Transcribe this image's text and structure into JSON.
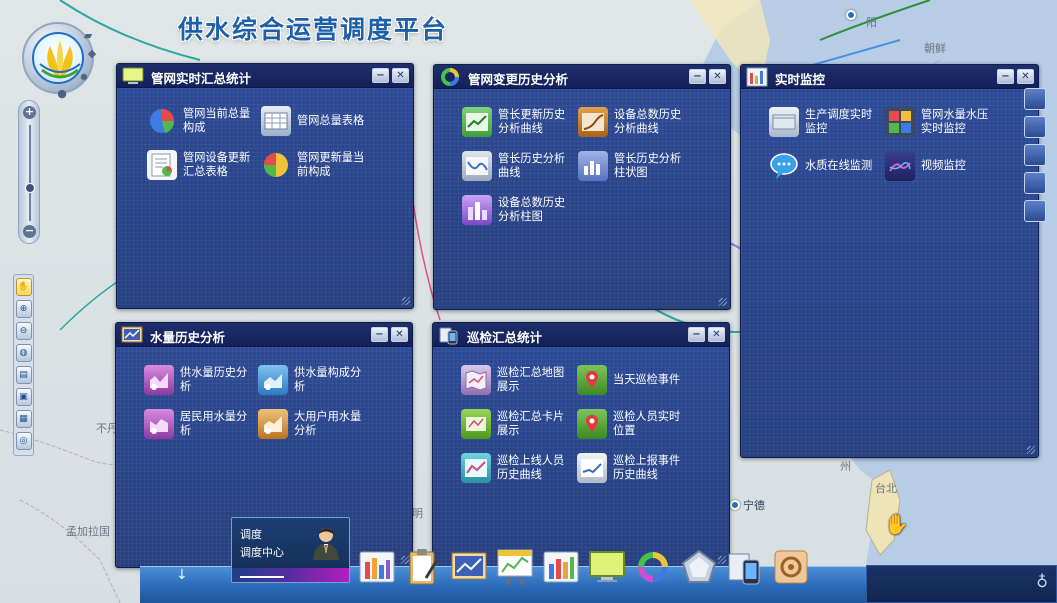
{
  "app": {
    "title": "供水综合运营调度平台"
  },
  "map_labels": {
    "yang": "阳",
    "shenyang": "沈阳",
    "chaoxian": "朝鲜",
    "bu": "不丹",
    "mengjiala": "孟加拉国",
    "kunming": "昆明",
    "zhou": "州",
    "taibei": "台北",
    "ningde": "宁德",
    "mingdeng": "明"
  },
  "panels": {
    "pipe_stats": {
      "title": "管网实时汇总统计",
      "items": [
        {
          "label": "管网当前总量构成",
          "icon": "pie-chart-icon"
        },
        {
          "label": "管网总量表格",
          "icon": "table-icon"
        },
        {
          "label": "管网设备更新汇总表格",
          "icon": "report-icon"
        },
        {
          "label": "管网更新量当前构成",
          "icon": "pie-chart-icon"
        }
      ]
    },
    "pipe_history": {
      "title": "管网变更历史分析",
      "items": [
        {
          "label": "管长更新历史分析曲线",
          "icon": "line-chart-icon"
        },
        {
          "label": "设备总数历史分析曲线",
          "icon": "curve-chart-icon"
        },
        {
          "label": "管长历史分析曲线",
          "icon": "line-chart-icon"
        },
        {
          "label": "管长历史分析柱状图",
          "icon": "bar-chart-icon"
        },
        {
          "label": "设备总数历史分析柱图",
          "icon": "bar-chart-icon"
        }
      ]
    },
    "realtime": {
      "title": "实时监控",
      "items": [
        {
          "label": "生产调度实时监控",
          "icon": "monitor-icon"
        },
        {
          "label": "管网水量水压实时监控",
          "icon": "grid-icon"
        },
        {
          "label": "水质在线监测",
          "icon": "chat-bubble-icon"
        },
        {
          "label": "视频监控",
          "icon": "video-icon"
        }
      ]
    },
    "water_history": {
      "title": "水量历史分析",
      "items": [
        {
          "label": "供水量历史分析",
          "icon": "water-chart-icon"
        },
        {
          "label": "供水量构成分析",
          "icon": "water-chart-icon"
        },
        {
          "label": "居民用水量分析",
          "icon": "water-chart-icon"
        },
        {
          "label": "大用户用水量分析",
          "icon": "water-chart-icon"
        }
      ]
    },
    "patrol": {
      "title": "巡检汇总统计",
      "items": [
        {
          "label": "巡检汇总地图展示",
          "icon": "map-icon"
        },
        {
          "label": "当天巡检事件",
          "icon": "event-icon"
        },
        {
          "label": "巡检汇总卡片展示",
          "icon": "card-icon"
        },
        {
          "label": "巡检人员实时位置",
          "icon": "location-icon"
        },
        {
          "label": "巡检上线人员历史曲线",
          "icon": "line-chart-icon"
        },
        {
          "label": "巡检上报事件历史曲线",
          "icon": "line-chart-icon"
        }
      ]
    }
  },
  "window_controls": {
    "minimize": "−",
    "close": "✕"
  },
  "user_card": {
    "line1": "调度",
    "line2": "调度中心"
  },
  "nav": {
    "zoom_in": "+",
    "zoom_out": "−"
  },
  "colors": {
    "panel_bg": "#2b468f",
    "panel_header": "#1a2a64",
    "title_blue": "#1d5fa8",
    "taskbar": "#2d6dbb"
  }
}
